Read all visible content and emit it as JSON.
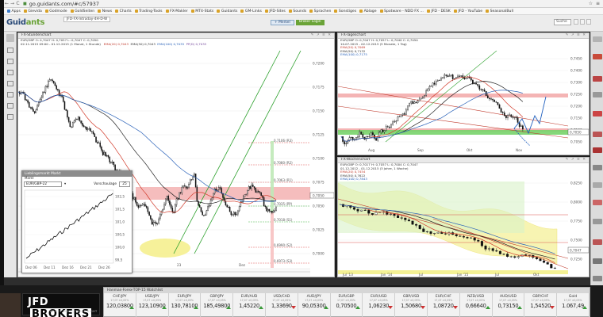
{
  "browser": {
    "url": "go.guidants.com/#c/57937",
    "nav_back": "←",
    "nav_forward": "→",
    "nav_reload": "C",
    "right_icons": [
      "☆",
      "≡"
    ]
  },
  "bookmarks": [
    {
      "label": "Apps"
    },
    {
      "label": "Gievida"
    },
    {
      "label": "Godmode"
    },
    {
      "label": "GoldSeiten"
    },
    {
      "label": "News"
    },
    {
      "label": "Charts"
    },
    {
      "label": "Trading-Tools"
    },
    {
      "label": "FX-Makler"
    },
    {
      "label": "MT4-Stats"
    },
    {
      "label": "Guidants"
    },
    {
      "label": "GM-Links"
    },
    {
      "label": "JFD-Sites"
    },
    {
      "label": "Sounds"
    },
    {
      "label": "Sprachen"
    },
    {
      "label": "Sonstiges"
    },
    {
      "label": "Ablage"
    },
    {
      "label": "Spotware - NDD FX ..."
    },
    {
      "label": "JFD - DESK"
    },
    {
      "label": "JFD - YouTube"
    },
    {
      "label": "SeasonalBull"
    }
  ],
  "header": {
    "logo_main": "Guid",
    "logo_accent": "ants",
    "tabs": [
      "JFD-FX-Intraday-4H-D-W"
    ],
    "follow_button": "+ Merkel",
    "broker_button": "Broker Login",
    "search_placeholder": "Suche"
  },
  "panels": {
    "left": {
      "title": "FX-Stundenchart",
      "controls": "✎ ↗ ≡ ✕",
      "info1": "EUR/GBP   O: 0,7047  H: 0,7057  L: 0,7047  C: 0,7050",
      "info2_date": "02.11.2015 09:00 - 01.12.2015 (1 Monat, 1 Stunde)",
      "ema20": "EMA(20)  0,7043",
      "ema50": "EMA(50)  0,7043",
      "ema100": "EMA(100)  0,7035",
      "ppd": "PP(D)  0,7035",
      "y_ticks": [
        "0,7200",
        "0,7175",
        "0,7150",
        "0,7125",
        "0,7100",
        "0,7075",
        "0,7050",
        "0,7025",
        "0,7000",
        "0,6975"
      ],
      "levels": [
        "0,7106 (R3)",
        "0,7080 (R2)",
        "0,7063 (R1)",
        "0,7035 (PP)",
        "0,7018 (S1)",
        "0,6990 (S2)",
        "0,6973 (S3)"
      ],
      "price_tag": "0,7050",
      "x_labels": [
        "23",
        "Dez"
      ]
    },
    "top_right": {
      "title": "FX-Tageschart",
      "controls": "✎ ↗ ≡ ✕",
      "info1": "EUR/GBP   O: 0,7047  H: 0,7057  L: 0,7040  C: 0,7050",
      "info2_date": "10.07.2015 - 02.12.2015 (5 Monate, 1 Tag)",
      "ema20": "EMA(20)  0,7069",
      "ema50": "EMA(50)  0,7132",
      "ema100": "EMA(100)  0,7175",
      "y_ticks": [
        "0,7450",
        "0,7400",
        "0,7300",
        "0,7250",
        "0,7200",
        "0,7150",
        "0,7100",
        "0,7050"
      ],
      "price_tag": "0,7050",
      "x_labels": [
        "Aug",
        "Sep",
        "Okt",
        "Nov"
      ],
      "wave_labels": [
        "K",
        "S"
      ]
    },
    "bottom_right": {
      "title": "FX-Wochenchart",
      "controls": "✎ ↗ ≡ ✕",
      "info1": "EUR/GBP   O: 0,7017  H: 0,7057  L: 0,7004  C: 0,7047",
      "info2_date": "01.12.2012 - 01.12.2015 (3 Jahre, 1 Woche)",
      "ema20": "EMA(20)  0,7454",
      "ema50": "EMA(50)  0,7622",
      "ema100": "EMA(100)  0,7843",
      "y_ticks": [
        "0,8250",
        "0,8000",
        "0,7750",
        "0,7500",
        "0,7250"
      ],
      "price_tag": "0,7047",
      "x_labels": [
        "Jul '13",
        "Jan '14",
        "Jul",
        "Jan '15",
        "Jul",
        "Okt"
      ]
    }
  },
  "mini": {
    "title": "Lieblingsmarkt Markt",
    "sub": "Markt",
    "symbol": "EUR/GBP-22",
    "label": "Vorschaulage",
    "value": "25",
    "y_ticks": [
      "102,5",
      "101,5",
      "101,0",
      "100,5",
      "100,0",
      "99,5"
    ],
    "x_labels": [
      "Dez 06",
      "Dez 11",
      "Dez 16",
      "Dez 21",
      "Dez 26"
    ]
  },
  "watchlist": {
    "title": "Hanmas-Forex-TOP-15 Watchlist",
    "items": [
      {
        "sym": "CHF/JPY",
        "val": "120,03800",
        "dir": "up"
      },
      {
        "sym": "USD/JPY",
        "val": "123,10900",
        "dir": "up"
      },
      {
        "sym": "EUR/JPY",
        "val": "130,78100",
        "dir": "up"
      },
      {
        "sym": "GBP/JPY",
        "val": "185,49800",
        "dir": "up"
      },
      {
        "sym": "EUR/AUD",
        "val": "1,45220",
        "dir": "up"
      },
      {
        "sym": "USD/CAD",
        "val": "1,33690",
        "dir": "down"
      },
      {
        "sym": "AUD/JPY",
        "val": "90,05300",
        "dir": "up"
      },
      {
        "sym": "EUR/GBP",
        "val": "0,70500",
        "dir": "up"
      },
      {
        "sym": "EUR/USD",
        "val": "1,06230",
        "dir": "down"
      },
      {
        "sym": "GBP/USD",
        "val": "1,50680",
        "dir": "down"
      },
      {
        "sym": "EUR/CHF",
        "val": "1,08720",
        "dir": "down"
      },
      {
        "sym": "NZD/USD",
        "val": "0,66640",
        "dir": "up"
      },
      {
        "sym": "AUD/USD",
        "val": "0,73150",
        "dir": "up"
      },
      {
        "sym": "GBP/CHF",
        "val": "1,54520",
        "dir": "down"
      },
      {
        "sym": "Gold",
        "val": "1.067,49",
        "dir": "up"
      }
    ],
    "sub_text": "17,07  ±0,05%"
  },
  "brand": {
    "jfd_main": "JFD",
    "jfd_box": "BROKERS",
    "jfd_tag": "INVEST RIGHT, TRADE RIGHT"
  },
  "colors": {
    "support_zone": "#78d36a",
    "resistance_zone": "#f2a7a7",
    "ellipse": "#f5ee88",
    "trendline": "#2ca02c",
    "candles": "#111111"
  }
}
